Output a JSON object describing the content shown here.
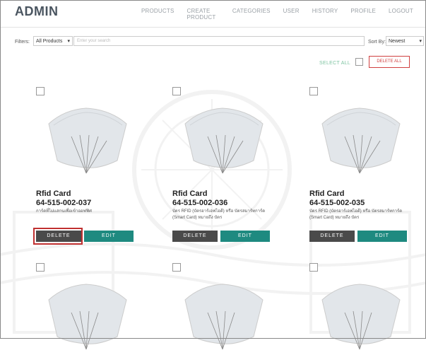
{
  "header": {
    "logo": "ADMIN",
    "nav": [
      "PRODUCTS",
      "CREATE PRODUCT",
      "CATEGORIES",
      "USER",
      "HISTORY",
      "PROFILE",
      "LOGOUT"
    ]
  },
  "filters": {
    "label": "Filters:",
    "product_select": "All Products",
    "search_placeholder": "Enter your search",
    "sort_label": "Sort By:",
    "sort_select": "Newest"
  },
  "select_all": {
    "label": "SELECT ALL",
    "delete_all": "DELETE ALL"
  },
  "products": [
    {
      "title": "Rfid Card",
      "code": "64-515-002-037",
      "desc": "การ์ดที่ไม่แสกนเพื่อเข้าออฟฟิศ",
      "delete": "DELETE",
      "edit": "EDIT"
    },
    {
      "title": "Rfid Card",
      "code": "64-515-002-036",
      "desc": "บัตร RFID (บัตรอาร์เอฟไอดี) หรือ บัตรสมาร์ทการ์ด (Smart Card) หมายถึง บัตร",
      "delete": "DELETE",
      "edit": "EDIT"
    },
    {
      "title": "Rfid Card",
      "code": "64-515-002-035",
      "desc": "บัตร RFID (บัตรอาร์เอฟไอดี) หรือ บัตรสมาร์ทการ์ด (Smart Card) หมายถึง บัตร",
      "delete": "DELETE",
      "edit": "EDIT"
    }
  ],
  "colors": {
    "accent": "#1e8a80",
    "delete": "#4a4a4a",
    "danger": "#d04040",
    "highlight": "#c03030"
  }
}
